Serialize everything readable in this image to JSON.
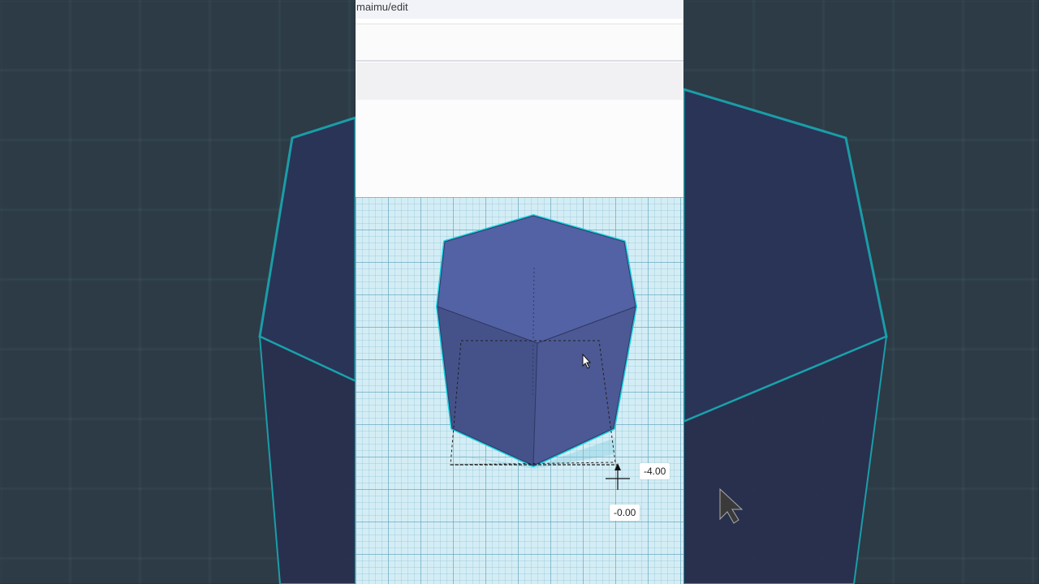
{
  "browser": {
    "url_fragment": "maimu/edit"
  },
  "workplane": {
    "shape": "hexagonal-prism",
    "shape_color": "#4f5fa0",
    "outline_color": "#18d0e0"
  },
  "dimensions": {
    "x_offset": "-4.00",
    "y_offset": "-0.00"
  },
  "icons": {
    "pointer": "mouse-pointer-icon",
    "move_handle": "move-arrow-icon"
  }
}
